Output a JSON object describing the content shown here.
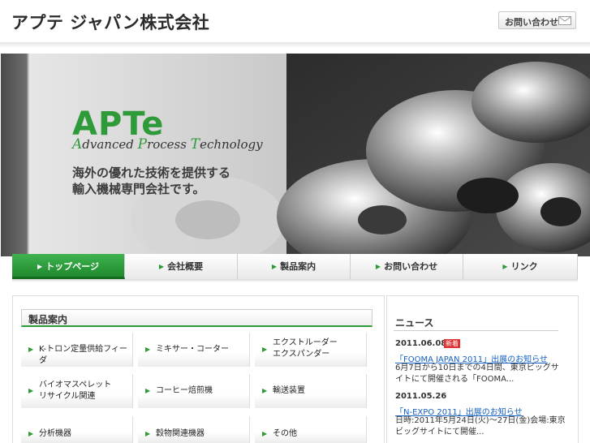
{
  "header": {
    "site_title": "アプテ ジャパン株式会社",
    "contact_button": "お問い合わせ"
  },
  "hero": {
    "logo": "APTe",
    "tagline": [
      {
        "initial": "A",
        "rest": "dvanced "
      },
      {
        "initial": "P",
        "rest": "rocess "
      },
      {
        "initial": "T",
        "rest": "echnology"
      }
    ],
    "copy_line1": "海外の優れた技術を提供する",
    "copy_line2": "輸入機械専門会社です。"
  },
  "nav": {
    "items": [
      {
        "label": "トップページ",
        "active": true
      },
      {
        "label": "会社概要",
        "active": false
      },
      {
        "label": "製品案内",
        "active": false
      },
      {
        "label": "お問い合わせ",
        "active": false
      },
      {
        "label": "リンク",
        "active": false
      }
    ]
  },
  "products": {
    "title": "製品案内",
    "items": [
      {
        "label": "K-トロン定量供給フィーダ"
      },
      {
        "label": "ミキサー・コーター"
      },
      {
        "label": "エクストルーダー\nエクスパンダー"
      },
      {
        "label": "バイオマスペレット\nリサイクル関連"
      },
      {
        "label": "コーヒー焙煎機"
      },
      {
        "label": "輸送装置"
      },
      {
        "label": "分析機器"
      },
      {
        "label": "穀物関連機器"
      },
      {
        "label": "その他"
      }
    ]
  },
  "news": {
    "title": "ニュース",
    "badge": "新着",
    "entries": [
      {
        "date": "2011.06.08",
        "link": "「FOOMA JAPAN 2011」出展のお知らせ",
        "body": "6月7日から10日までの4日間、東京ビッグサイトにて開催される「FOOMA..."
      },
      {
        "date": "2011.05.26",
        "link": "「N-EXPO 2011」出展のお知らせ",
        "body": "日時:2011年5月24日(火)～27日(金)会場:東京ビッグサイトにて開催..."
      }
    ]
  },
  "colors": {
    "brand_green": "#2f9a3a",
    "link_blue": "#1560c0",
    "badge_red": "#e03030"
  }
}
